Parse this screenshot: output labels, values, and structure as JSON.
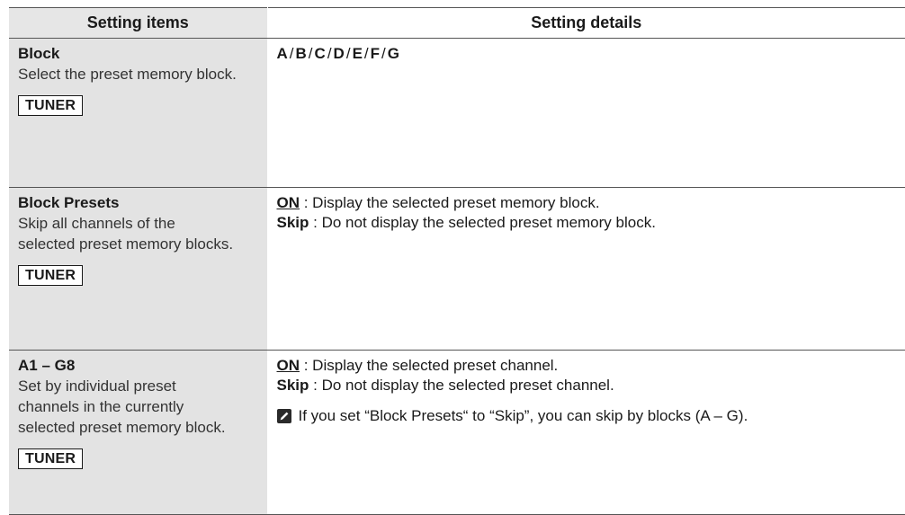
{
  "header": {
    "left": "Setting items",
    "right": "Setting details"
  },
  "rows": [
    {
      "title": "Block",
      "description": "Select the preset memory block.",
      "badge": "TUNER",
      "values": [
        "A",
        "B",
        "C",
        "D",
        "E",
        "F",
        "G"
      ],
      "separator": "/"
    },
    {
      "title": "Block Presets",
      "description": "Skip all channels of the selected preset memory blocks.",
      "badge": "TUNER",
      "details": [
        {
          "option": "ON",
          "underlined": true,
          "text": ": Display the selected preset memory block."
        },
        {
          "option": "Skip",
          "underlined": false,
          "text": ": Do not display the selected preset memory block."
        }
      ]
    },
    {
      "title": "A1 – G8",
      "description": "Set by individual preset channels in the currently selected preset memory block.",
      "badge": "TUNER",
      "details": [
        {
          "option": "ON",
          "underlined": true,
          "text": ": Display the selected preset channel."
        },
        {
          "option": "Skip",
          "underlined": false,
          "text": ": Do not display the selected preset channel."
        }
      ],
      "note": {
        "icon": "pencil-icon",
        "text": "If you set “Block Presets“ to “Skip”, you can skip by blocks (A – G)."
      }
    }
  ]
}
